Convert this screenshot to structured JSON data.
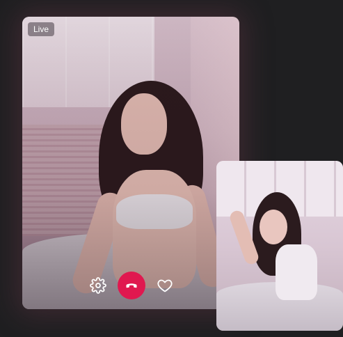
{
  "call": {
    "status_badge": "Live"
  },
  "controls": {
    "settings_icon": "gear-icon",
    "end_call_icon": "phone-hangup-icon",
    "like_icon": "heart-icon"
  },
  "colors": {
    "background": "#1f1f21",
    "end_call": "#e0184f",
    "icon": "#ffffff"
  }
}
